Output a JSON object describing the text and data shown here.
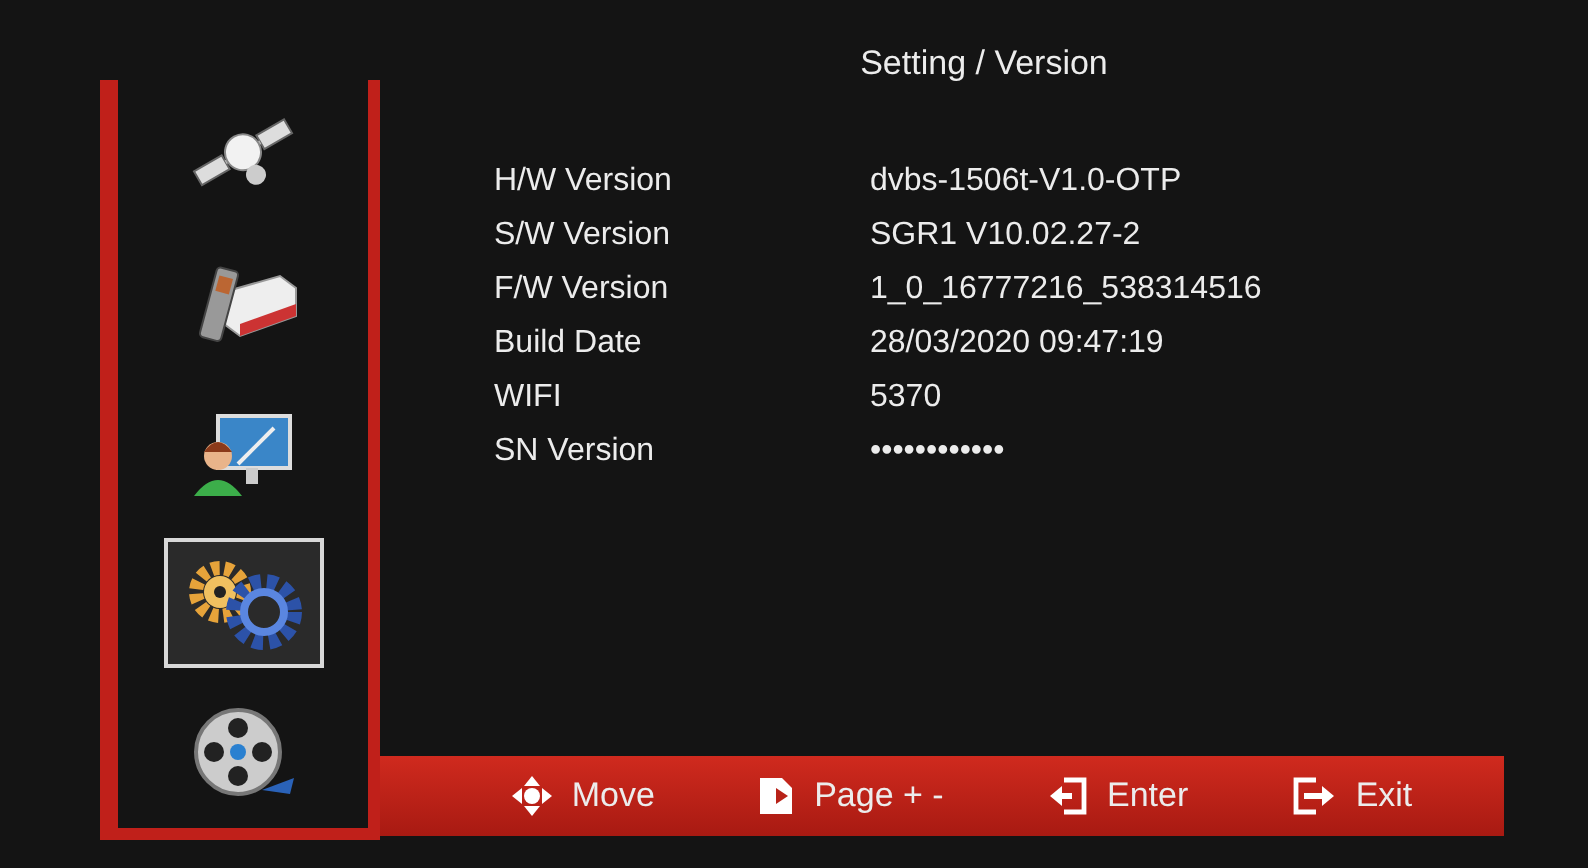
{
  "menu": {
    "items": [
      {
        "selected": false
      },
      {
        "selected": false
      },
      {
        "selected": false
      },
      {
        "selected": true
      },
      {
        "selected": false
      }
    ]
  },
  "title": "Setting / Version",
  "info": [
    {
      "label": "H/W Version",
      "value": "dvbs-1506t-V1.0-OTP"
    },
    {
      "label": "S/W Version",
      "value": "SGR1 V10.02.27-2"
    },
    {
      "label": "F/W Version",
      "value": "1_0_16777216_538314516"
    },
    {
      "label": "Build Date",
      "value": "28/03/2020 09:47:19"
    },
    {
      "label": "WIFI",
      "value": "5370"
    },
    {
      "label": "SN Version",
      "value": "••••••••••••"
    }
  ],
  "hints": [
    {
      "label": "Move"
    },
    {
      "label": "Page + -"
    },
    {
      "label": "Enter"
    },
    {
      "label": "Exit"
    }
  ]
}
